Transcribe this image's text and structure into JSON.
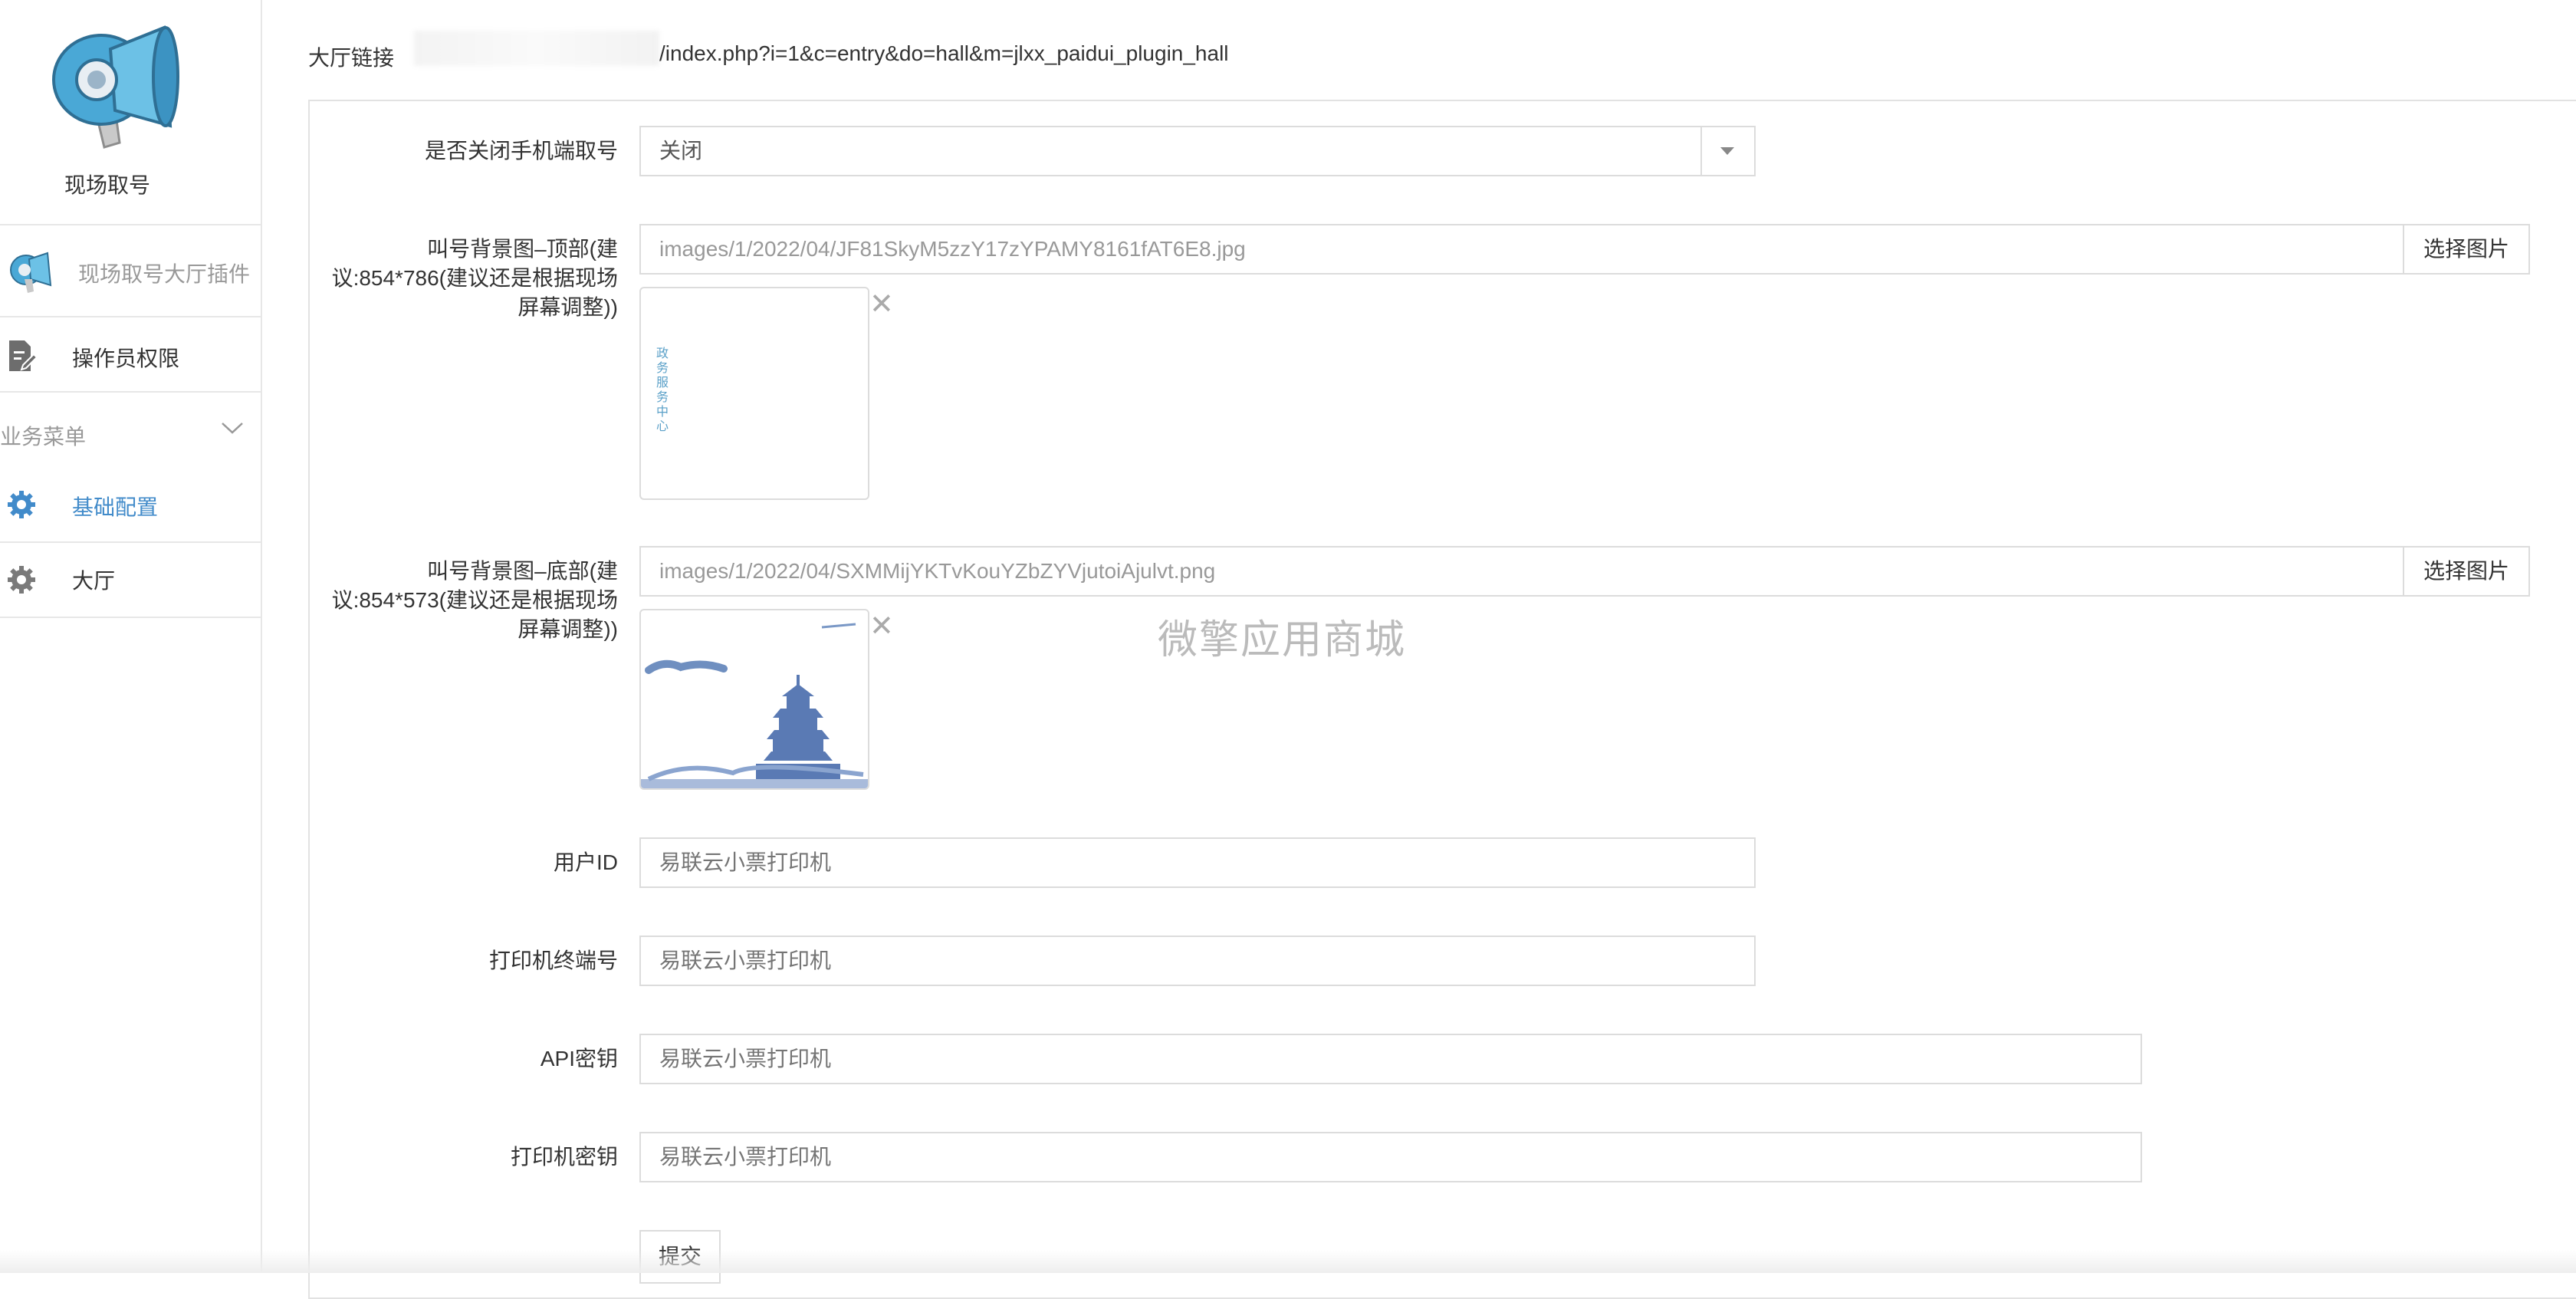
{
  "sidebar": {
    "app_name": "现场取号",
    "plugin_label": "现场取号大厅插件",
    "operator_label": "操作员权限",
    "menu_label": "业务菜单",
    "items": [
      {
        "label": "基础配置",
        "active": true,
        "icon": "gear-icon"
      },
      {
        "label": "大厅",
        "active": false,
        "icon": "gear-icon"
      }
    ],
    "accent_color": "#428bca"
  },
  "hall_link": {
    "label": "大厅链接",
    "url": "/index.php?i=1&c=entry&do=hall&m=jlxx_paidui_plugin_hall"
  },
  "form": {
    "close_mobile": {
      "label": "是否关闭手机端取号",
      "value": "关闭"
    },
    "bg_top": {
      "label_lines": [
        "叫号背景图–顶部(建",
        "议:854*786(建议还是根据现场",
        "屏幕调整))"
      ],
      "value": "images/1/2022/04/JF81SkyM5zzY17zYPAMY8161fAT6E8.jpg",
      "button": "选择图片",
      "preview_text": "政务服务中心"
    },
    "bg_bottom": {
      "label_lines": [
        "叫号背景图–底部(建",
        "议:854*573(建议还是根据现场",
        "屏幕调整))"
      ],
      "value": "images/1/2022/04/SXMMijYKTvKouYZbZYVjutoiAjulvt.png",
      "button": "选择图片"
    },
    "user_id": {
      "label": "用户ID",
      "placeholder": "易联云小票打印机"
    },
    "terminal_no": {
      "label": "打印机终端号",
      "placeholder": "易联云小票打印机"
    },
    "api_key": {
      "label": "API密钥",
      "placeholder": "易联云小票打印机"
    },
    "printer_key": {
      "label": "打印机密钥",
      "placeholder": "易联云小票打印机"
    },
    "submit": "提交",
    "remove_glyph": "✕"
  },
  "watermark": "微擎应用商城"
}
